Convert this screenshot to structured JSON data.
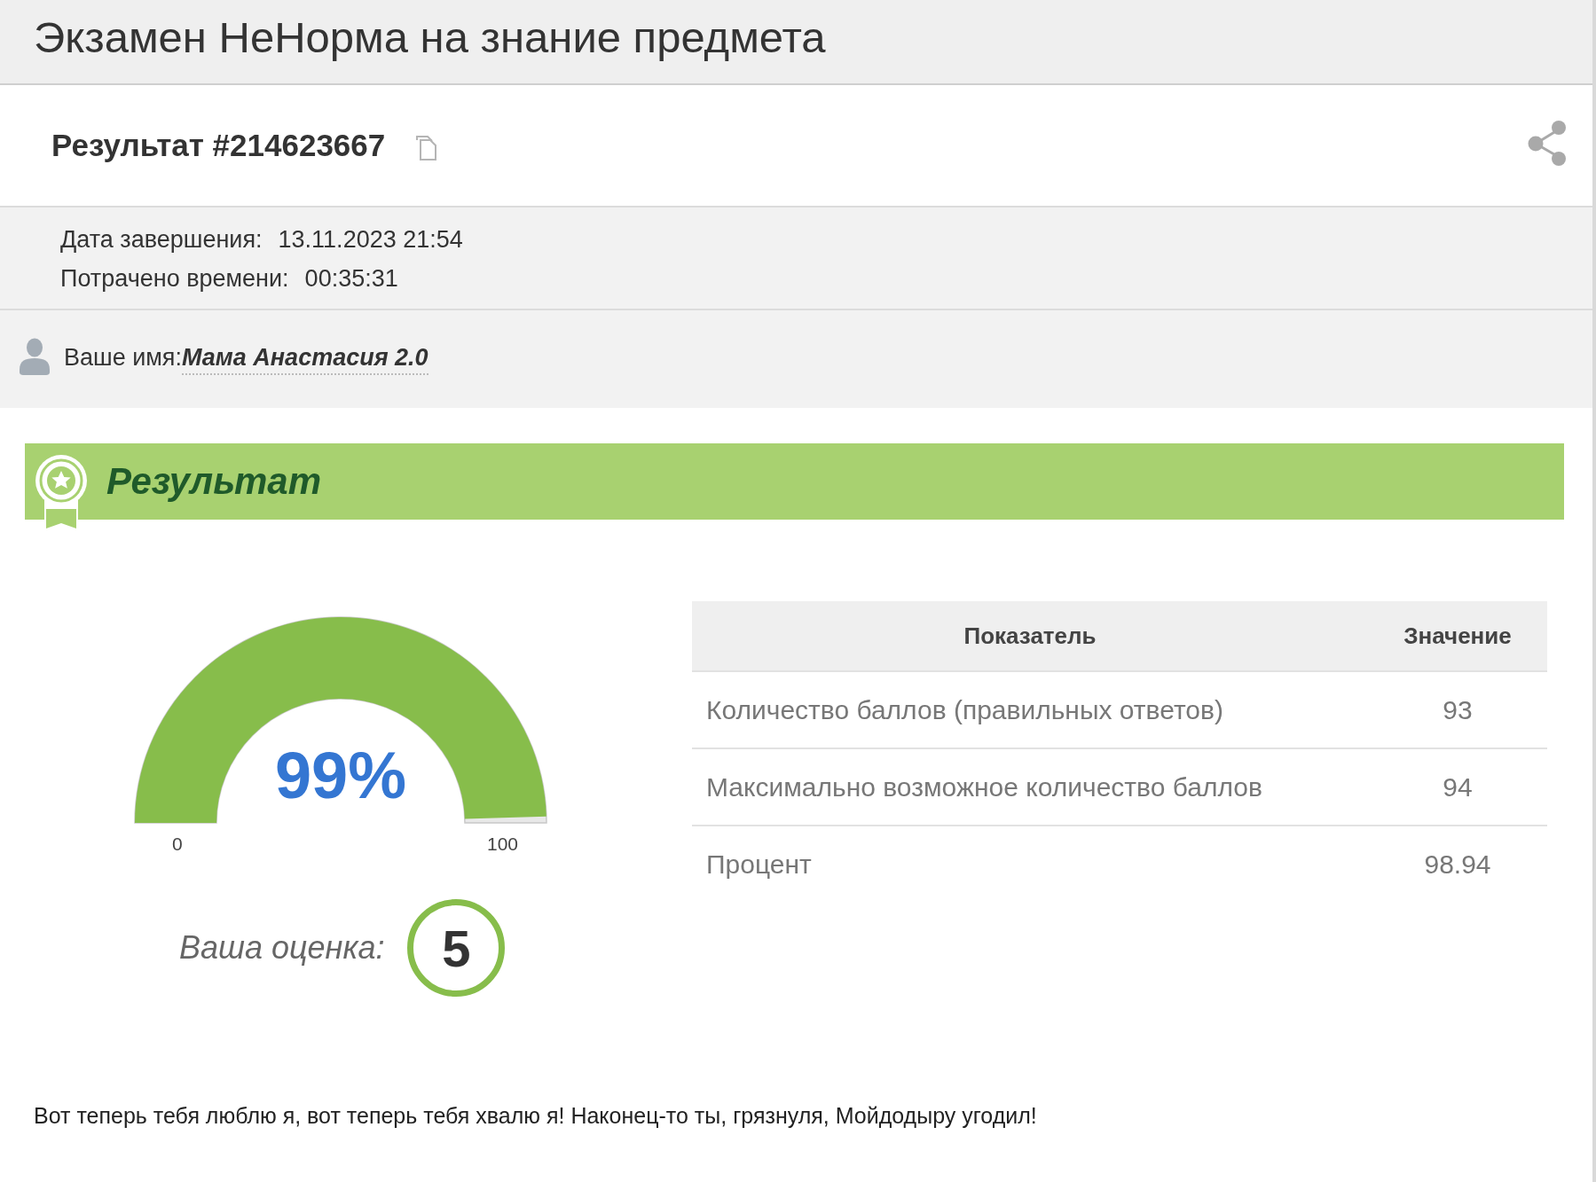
{
  "header": {
    "title": "Экзамен НеНорма на знание предмета"
  },
  "result": {
    "title": "Результат #214623667"
  },
  "info": [
    {
      "label": "Дата завершения:",
      "value": "13.11.2023 21:54"
    },
    {
      "label": "Потрачено времени:",
      "value": "00:35:31"
    }
  ],
  "user": {
    "label": "Ваше имя:",
    "name": "Мама Анастасия 2.0"
  },
  "banner": {
    "title": "Результат"
  },
  "gauge": {
    "value": "99%",
    "level": 0.99,
    "min_label": "0",
    "max_label": "100"
  },
  "table": {
    "columns": [
      "Показатель",
      "Значение"
    ],
    "rows": [
      [
        "Количество баллов (правильных ответов)",
        "93"
      ],
      [
        "Максимально возможное количество баллов",
        "94"
      ],
      [
        "Процент",
        "98.94"
      ]
    ]
  },
  "grade": {
    "label": "Ваша оценка:",
    "value": "5"
  },
  "message": "Вот теперь тебя люблю я, вот теперь тебя хвалю я! Наконец-то ты, грязнуля, Мойдодыру угодил!"
}
